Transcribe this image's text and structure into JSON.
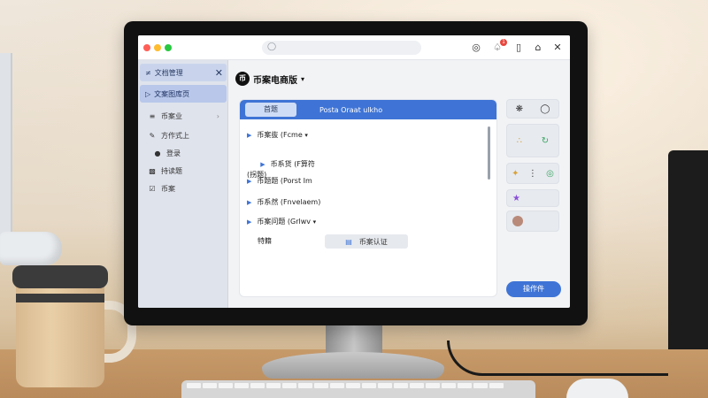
{
  "browser": {
    "url_icon": "lock-icon",
    "toolbar_icons": [
      "target-icon",
      "bell-icon",
      "tablet-icon",
      "store-icon",
      "close-icon"
    ],
    "notification_badge": "1"
  },
  "sidebar": {
    "header_label": "文档管理",
    "active_label": "文案图库页",
    "items": [
      {
        "label": "币案业",
        "icon": "list-icon"
      },
      {
        "label": "方作式上",
        "icon": "pencil-icon"
      },
      {
        "label": "登录",
        "icon": "person-icon"
      },
      {
        "label": "持读题",
        "icon": "grid-icon"
      },
      {
        "label": "币案",
        "icon": "check-icon"
      }
    ]
  },
  "main": {
    "logo_glyph": "币",
    "title": "币案电商版",
    "panel": {
      "tab_label": "首题",
      "header_text": "Posta Oraat ulkho",
      "rows": [
        "币案抜 (Fcme",
        "币系货 (F算符\n(拐题)",
        "币题题 (Porst Im",
        "币系然 (Fnvelaem)",
        "币案问题 (Grlwv"
      ],
      "footer_label": "特籍",
      "inline_button": "币案认证"
    }
  },
  "rail": {
    "primary_button": "操作件"
  },
  "colors": {
    "accent": "#3f74d6",
    "sidebar_bg": "#dfe3ec",
    "badge": "#e8453c"
  }
}
